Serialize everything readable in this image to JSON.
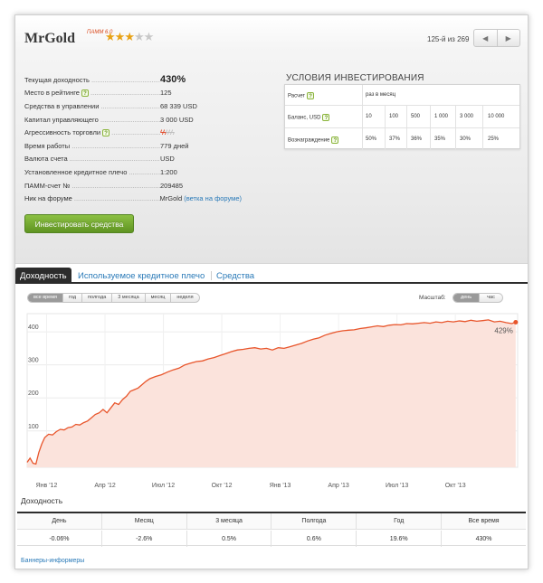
{
  "header": {
    "name": "MrGold",
    "tag": "ПАММ 6.0",
    "rating_stars_on": 3,
    "rating_stars_total": 5,
    "counter": "125-й из 269",
    "prev_icon": "chevron-left-icon",
    "next_icon": "chevron-right-icon"
  },
  "stats": {
    "rows": [
      {
        "label": "Текущая доходность",
        "value": "430%",
        "big": true
      },
      {
        "label": "Место в рейтинге",
        "value": "125",
        "help": true
      },
      {
        "label": "Средства в управлении",
        "value": "68 339 USD"
      },
      {
        "label": "Капитал управляющего",
        "value": "3 000 USD"
      },
      {
        "label": "Агрессивность торговли",
        "value": "",
        "help": true,
        "aggression_level": 2,
        "aggression_max": 5
      },
      {
        "label": "Время работы",
        "value": "779 дней"
      },
      {
        "label": "Валюта счета",
        "value": "USD"
      },
      {
        "label": "Установленное кредитное плечо",
        "value": "1:200"
      },
      {
        "label": "ПАММ-счет №",
        "value": "209485"
      },
      {
        "label": "Ник на форуме",
        "value": "MrGold",
        "link": "(ветка на форуме)"
      }
    ]
  },
  "invest_button": "Инвестировать средства",
  "terms": {
    "title": "УСЛОВИЯ ИНВЕСТИРОВАНИЯ",
    "calc_label": "Расчет",
    "calc_value": "раз в месяц",
    "balance_label": "Баланс, USD",
    "balance_values": [
      "10",
      "100",
      "500",
      "1 000",
      "3 000",
      "10 000"
    ],
    "reward_label": "Вознаграждение",
    "reward_values": [
      "50%",
      "37%",
      "36%",
      "35%",
      "30%",
      "25%"
    ]
  },
  "tabs": [
    {
      "label": "Доходность",
      "active": true
    },
    {
      "label": "Используемое кредитное плечо",
      "active": false
    },
    {
      "label": "Средства",
      "active": false
    }
  ],
  "chart_controls": {
    "periods": [
      {
        "label": "все время",
        "active": true
      },
      {
        "label": "год",
        "active": false
      },
      {
        "label": "полгода",
        "active": false
      },
      {
        "label": "3 месяца",
        "active": false
      },
      {
        "label": "месяц",
        "active": false
      },
      {
        "label": "неделя",
        "active": false
      }
    ],
    "scale_label": "Масштаб:",
    "scales": [
      {
        "label": "день",
        "active": true
      },
      {
        "label": "час",
        "active": false
      }
    ]
  },
  "chart_data": {
    "type": "area",
    "title": "",
    "xlabel": "",
    "ylabel": "",
    "y_ticks": [
      100,
      200,
      300,
      400
    ],
    "ylim": [
      -10,
      455
    ],
    "x_ticks": [
      "Янв '12",
      "Апр '12",
      "Июл '12",
      "Окт '12",
      "Янв '13",
      "Апр '13",
      "Июл '13",
      "Окт '13"
    ],
    "x_tick_positions": [
      1,
      4,
      7,
      10,
      13,
      16,
      19,
      22
    ],
    "xlim": [
      0,
      25.2
    ],
    "end_label": "429%",
    "line_color": "#e8552b",
    "fill_color": "#fbe3dc",
    "series": [
      {
        "x": [
          0,
          0.15,
          0.3,
          0.45,
          0.6,
          0.75,
          0.9,
          1.1,
          1.3,
          1.5,
          1.7,
          1.9,
          2.1,
          2.3,
          2.5,
          2.7,
          2.9,
          3.1,
          3.3,
          3.5,
          3.7,
          3.9,
          4.1,
          4.3,
          4.5,
          4.7,
          4.9,
          5.1,
          5.3,
          5.5,
          5.7,
          5.9,
          6.1,
          6.3,
          6.6,
          6.9,
          7.2,
          7.5,
          7.8,
          8.1,
          8.4,
          8.7,
          9.0,
          9.3,
          9.6,
          9.9,
          10.2,
          10.5,
          10.8,
          11.1,
          11.4,
          11.7,
          12.0,
          12.3,
          12.6,
          12.9,
          13.2,
          13.5,
          13.8,
          14.1,
          14.4,
          14.7,
          15.0,
          15.3,
          15.6,
          15.9,
          16.2,
          16.5,
          16.8,
          17.1,
          17.4,
          17.7,
          18.0,
          18.3,
          18.6,
          18.9,
          19.2,
          19.5,
          19.8,
          20.1,
          20.4,
          20.7,
          21.0,
          21.3,
          21.6,
          21.9,
          22.2,
          22.5,
          22.8,
          23.1,
          23.4,
          23.7,
          24.0,
          24.3,
          24.6,
          24.9,
          25.1
        ],
        "values": [
          5,
          18,
          2,
          0,
          35,
          60,
          80,
          90,
          88,
          98,
          105,
          103,
          110,
          112,
          120,
          118,
          125,
          130,
          140,
          150,
          155,
          165,
          155,
          170,
          185,
          180,
          195,
          205,
          220,
          225,
          230,
          240,
          250,
          258,
          265,
          270,
          278,
          285,
          290,
          300,
          305,
          310,
          312,
          318,
          322,
          328,
          334,
          340,
          345,
          347,
          350,
          352,
          348,
          350,
          345,
          352,
          350,
          355,
          360,
          365,
          372,
          378,
          382,
          390,
          395,
          400,
          403,
          405,
          406,
          410,
          412,
          415,
          418,
          416,
          420,
          422,
          421,
          425,
          424,
          426,
          428,
          426,
          430,
          428,
          432,
          430,
          433,
          431,
          435,
          432,
          434,
          436,
          430,
          432,
          428,
          425,
          429
        ]
      }
    ]
  },
  "returns": {
    "title": "Доходность",
    "headers": [
      "День",
      "Месяц",
      "3 месяца",
      "Полгода",
      "Год",
      "Все время"
    ],
    "values": [
      "-0.06%",
      "-2.6%",
      "0.5%",
      "0.6%",
      "19.6%",
      "430%"
    ]
  },
  "footer_link": "Баннеры-информеры"
}
